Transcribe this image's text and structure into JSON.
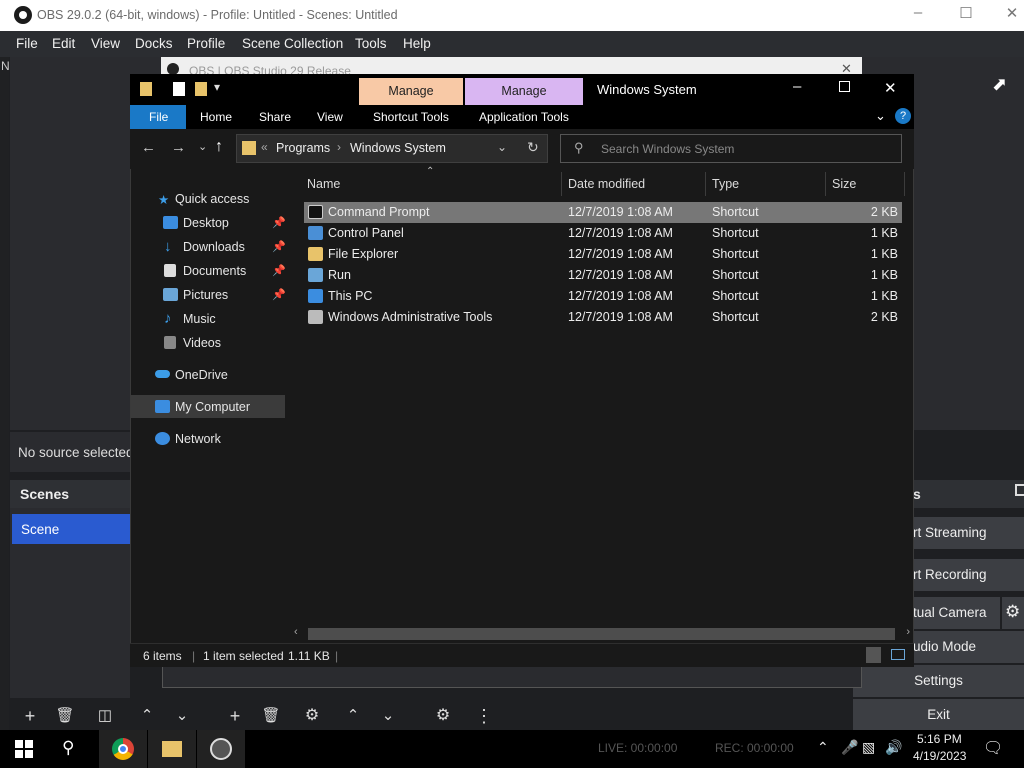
{
  "obs": {
    "title": "OBS 29.0.2 (64-bit, windows) - Profile: Untitled - Scenes: Untitled",
    "menu": [
      "File",
      "Edit",
      "View",
      "Docks",
      "Profile",
      "Scene Collection",
      "Tools",
      "Help"
    ],
    "behind_title": "OBS | OBS Studio 29 Release",
    "no_source": "No source selected",
    "scenes_header": "Scenes",
    "scene_item": "Scene",
    "controls": {
      "start_streaming": "rt Streaming",
      "start_recording": "rt Recording",
      "virtual_camera": "tual Camera",
      "studio_mode": "udio Mode",
      "settings": "Settings",
      "exit": "Exit",
      "header_fragment": "s"
    },
    "left_edge_fragment": "N",
    "status": {
      "live": "LIVE: 00:00:00",
      "rec": "REC: 00:00:00"
    }
  },
  "explorer": {
    "title": "Windows System",
    "context_tabs": [
      "Manage",
      "Manage"
    ],
    "ribbon_tabs": [
      "File",
      "Home",
      "Share",
      "View",
      "Shortcut Tools",
      "Application Tools"
    ],
    "address": {
      "prefix": "«",
      "parts": [
        "Programs",
        "Windows System"
      ]
    },
    "search_placeholder": "Search Windows System",
    "nav": [
      {
        "label": "Quick access",
        "pinned": false
      },
      {
        "label": "Desktop",
        "pinned": true
      },
      {
        "label": "Downloads",
        "pinned": true
      },
      {
        "label": "Documents",
        "pinned": true
      },
      {
        "label": "Pictures",
        "pinned": true
      },
      {
        "label": "Music",
        "pinned": false
      },
      {
        "label": "Videos",
        "pinned": false
      },
      {
        "label": "OneDrive",
        "pinned": false
      },
      {
        "label": "My Computer",
        "pinned": false
      },
      {
        "label": "Network",
        "pinned": false
      }
    ],
    "columns": [
      "Name",
      "Date modified",
      "Type",
      "Size"
    ],
    "files": [
      {
        "name": "Command Prompt",
        "date": "12/7/2019 1:08 AM",
        "type": "Shortcut",
        "size": "2 KB"
      },
      {
        "name": "Control Panel",
        "date": "12/7/2019 1:08 AM",
        "type": "Shortcut",
        "size": "1 KB"
      },
      {
        "name": "File Explorer",
        "date": "12/7/2019 1:08 AM",
        "type": "Shortcut",
        "size": "1 KB"
      },
      {
        "name": "Run",
        "date": "12/7/2019 1:08 AM",
        "type": "Shortcut",
        "size": "1 KB"
      },
      {
        "name": "This PC",
        "date": "12/7/2019 1:08 AM",
        "type": "Shortcut",
        "size": "1 KB"
      },
      {
        "name": "Windows Administrative Tools",
        "date": "12/7/2019 1:08 AM",
        "type": "Shortcut",
        "size": "2 KB"
      }
    ],
    "status": {
      "items": "6 items",
      "selected": "1 item selected",
      "size": "1.11 KB"
    }
  },
  "taskbar": {
    "time": "5:16 PM",
    "date": "4/19/2023"
  },
  "colors": {
    "accent": "#2a5bd0",
    "file_tab": "#1a79c7",
    "manage1": "#f8c9a6",
    "manage2": "#d9b6f2"
  }
}
